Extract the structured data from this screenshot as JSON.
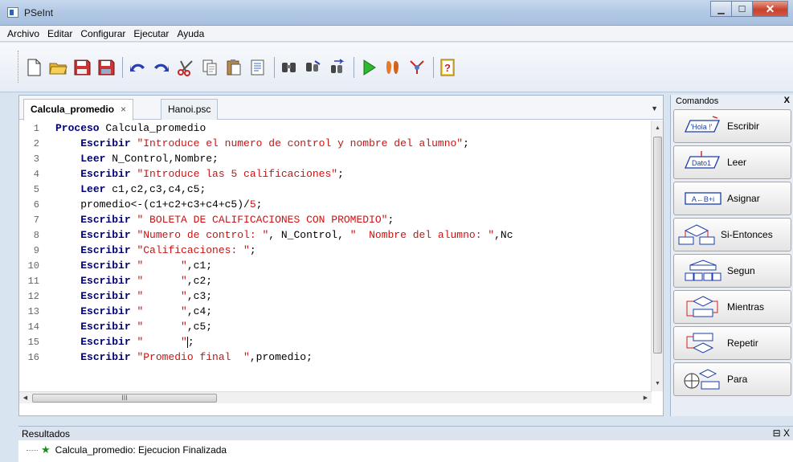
{
  "window": {
    "title": "PSeInt"
  },
  "menu": [
    "Archivo",
    "Editar",
    "Configurar",
    "Ejecutar",
    "Ayuda"
  ],
  "tabs": [
    {
      "label": "Calcula_promedio",
      "close": "×"
    },
    {
      "label": "Hanoi.psc"
    }
  ],
  "code_lines": [
    {
      "n": "1",
      "parts": [
        [
          "kw",
          "Proceso "
        ],
        [
          "plain",
          "Calcula_promedio"
        ]
      ]
    },
    {
      "n": "2",
      "parts": [
        [
          "plain",
          "    "
        ],
        [
          "kw",
          "Escribir "
        ],
        [
          "str",
          "\"Introduce el numero de control y nombre del alumno\""
        ],
        [
          "plain",
          ";"
        ]
      ]
    },
    {
      "n": "3",
      "parts": [
        [
          "plain",
          "    "
        ],
        [
          "kw",
          "Leer "
        ],
        [
          "plain",
          "N_Control,Nombre;"
        ]
      ]
    },
    {
      "n": "4",
      "parts": [
        [
          "plain",
          "    "
        ],
        [
          "kw",
          "Escribir "
        ],
        [
          "str",
          "\"Introduce las 5 calificaciones\""
        ],
        [
          "plain",
          ";"
        ]
      ]
    },
    {
      "n": "5",
      "parts": [
        [
          "plain",
          "    "
        ],
        [
          "kw",
          "Leer "
        ],
        [
          "plain",
          "c1,c2,c3,c4,c5;"
        ]
      ]
    },
    {
      "n": "6",
      "parts": [
        [
          "plain",
          "    promedio<-(c1+c2+c3+c4+c5)/"
        ],
        [
          "num",
          "5"
        ],
        [
          "plain",
          ";"
        ]
      ]
    },
    {
      "n": "7",
      "parts": [
        [
          "plain",
          "    "
        ],
        [
          "kw",
          "Escribir "
        ],
        [
          "str",
          "\" BOLETA DE CALIFICACIONES CON PROMEDIO\""
        ],
        [
          "plain",
          ";"
        ]
      ]
    },
    {
      "n": "8",
      "parts": [
        [
          "plain",
          "    "
        ],
        [
          "kw",
          "Escribir "
        ],
        [
          "str",
          "\"Numero de control: \""
        ],
        [
          "plain",
          ", N_Control, "
        ],
        [
          "str",
          "\"  Nombre del alumno: \""
        ],
        [
          "plain",
          ",Nc"
        ]
      ]
    },
    {
      "n": "9",
      "parts": [
        [
          "plain",
          "    "
        ],
        [
          "kw",
          "Escribir "
        ],
        [
          "str",
          "\"Calificaciones: \""
        ],
        [
          "plain",
          ";"
        ]
      ]
    },
    {
      "n": "10",
      "parts": [
        [
          "plain",
          "    "
        ],
        [
          "kw",
          "Escribir "
        ],
        [
          "str",
          "\"      \""
        ],
        [
          "plain",
          ",c1;"
        ]
      ]
    },
    {
      "n": "11",
      "parts": [
        [
          "plain",
          "    "
        ],
        [
          "kw",
          "Escribir "
        ],
        [
          "str",
          "\"      \""
        ],
        [
          "plain",
          ",c2;"
        ]
      ]
    },
    {
      "n": "12",
      "parts": [
        [
          "plain",
          "    "
        ],
        [
          "kw",
          "Escribir "
        ],
        [
          "str",
          "\"      \""
        ],
        [
          "plain",
          ",c3;"
        ]
      ]
    },
    {
      "n": "13",
      "parts": [
        [
          "plain",
          "    "
        ],
        [
          "kw",
          "Escribir "
        ],
        [
          "str",
          "\"      \""
        ],
        [
          "plain",
          ",c4;"
        ]
      ]
    },
    {
      "n": "14",
      "parts": [
        [
          "plain",
          "    "
        ],
        [
          "kw",
          "Escribir "
        ],
        [
          "str",
          "\"      \""
        ],
        [
          "plain",
          ",c5;"
        ]
      ]
    },
    {
      "n": "15",
      "parts": [
        [
          "plain",
          "    "
        ],
        [
          "kw",
          "Escribir "
        ],
        [
          "str",
          "\"      \""
        ],
        [
          "caret",
          ""
        ],
        [
          "plain",
          ";"
        ]
      ]
    },
    {
      "n": "16",
      "parts": [
        [
          "plain",
          "    "
        ],
        [
          "kw",
          "Escribir "
        ],
        [
          "str",
          "\"Promedio final  \""
        ],
        [
          "plain",
          ",promedio;"
        ]
      ]
    }
  ],
  "commands_panel": {
    "title": "Comandos",
    "close": "X",
    "items": [
      {
        "label": "Escribir",
        "icon": "write-icon",
        "badge": "'Hola !'"
      },
      {
        "label": "Leer",
        "icon": "read-icon",
        "badge": "Dato1"
      },
      {
        "label": "Asignar",
        "icon": "assign-icon",
        "badge": "A←B+i"
      },
      {
        "label": "Si-Entonces",
        "icon": "if-icon"
      },
      {
        "label": "Segun",
        "icon": "switch-icon"
      },
      {
        "label": "Mientras",
        "icon": "while-icon"
      },
      {
        "label": "Repetir",
        "icon": "repeat-icon"
      },
      {
        "label": "Para",
        "icon": "for-icon"
      }
    ]
  },
  "results": {
    "title": "Resultados",
    "controls": "⊟ X",
    "message": "Calcula_promedio: Ejecucion Finalizada"
  },
  "hscroll_label": "III"
}
